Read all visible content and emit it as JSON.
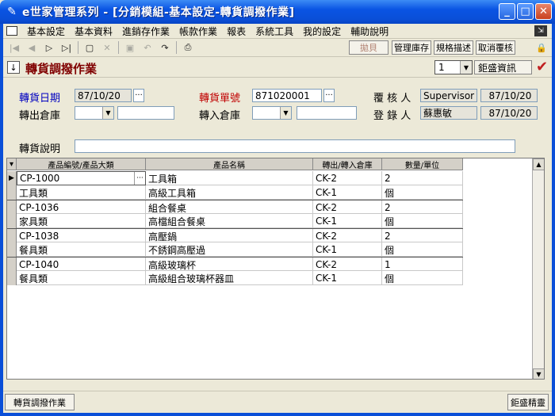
{
  "window": {
    "title": "e世家管理系列 - [分銷模組-基本設定-轉貨調撥作業]",
    "min_label": "_",
    "max_label": "□",
    "close_label": "✕"
  },
  "menu": [
    "基本設定",
    "基本資料",
    "進銷存作業",
    "帳款作業",
    "報表",
    "系統工具",
    "我的設定",
    "輔助說明"
  ],
  "toolbar": {
    "icons": [
      "first-icon",
      "prev-icon",
      "next-icon",
      "last-icon",
      "new-icon",
      "delete-icon",
      "save-icon",
      "undo-icon",
      "redo-icon",
      "print-icon"
    ],
    "buttons": {
      "transfer": "拋貝",
      "manage_stock": "管理庫存",
      "spec_desc": "規格描述",
      "cancel_review": "取消覆核"
    }
  },
  "form": {
    "title": "轉貨調撥作業",
    "page_select": "1",
    "company": "鉅盛資訊",
    "transfer_date_label": "轉貨日期",
    "transfer_date": "87/10/20",
    "transfer_no_label": "轉貨單號",
    "transfer_no": "871020001",
    "reviewer_label": "覆 核 人",
    "reviewer": "Supervisor",
    "review_date": "87/10/20",
    "out_warehouse_label": "轉出倉庫",
    "in_warehouse_label": "轉入倉庫",
    "recorder_label": "登 錄 人",
    "recorder": "蘇惠敏",
    "record_date": "87/10/20",
    "desc_label": "轉貨說明",
    "desc": ""
  },
  "grid": {
    "columns": [
      "產品編號/產品大類",
      "產品名稱",
      "轉出/轉入倉庫",
      "數量/單位"
    ],
    "rows": [
      [
        "CP-1000",
        "工具箱",
        "CK-2",
        "2"
      ],
      [
        "工具類",
        "高級工具箱",
        "CK-1",
        "個"
      ],
      [
        "CP-1036",
        "組合餐桌",
        "CK-2",
        "2"
      ],
      [
        "家具類",
        "高檔組合餐桌",
        "CK-1",
        "個"
      ],
      [
        "CP-1038",
        "高壓鍋",
        "CK-2",
        "2"
      ],
      [
        "餐具類",
        "不銹鋼高壓過",
        "CK-1",
        "個"
      ],
      [
        "CP-1040",
        "高級玻璃杯",
        "CK-2",
        "1"
      ],
      [
        "餐具類",
        "高級組合玻璃杯器皿",
        "CK-1",
        "個"
      ]
    ]
  },
  "status": {
    "left": "轉貨調撥作業",
    "right": "鉅盛精靈"
  }
}
